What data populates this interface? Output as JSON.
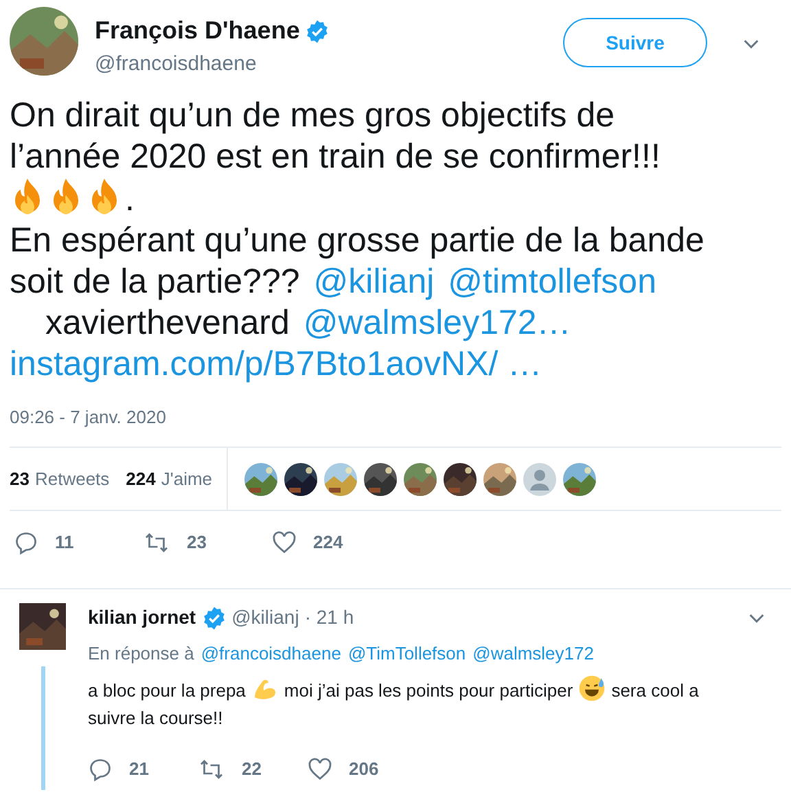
{
  "author": {
    "name": "François D'haene",
    "handle": "@francoisdhaene",
    "verified": true,
    "avatar": {
      "kind": "picture"
    }
  },
  "follow_button": "Suivre",
  "body": [
    [
      {
        "kind": "text",
        "text": "On dirait qu’un de mes gros objectifs de"
      }
    ],
    [
      {
        "kind": "text",
        "text": "l’année 2020 est en train de se confirmer!!!"
      }
    ],
    [
      {
        "kind": "fire"
      },
      {
        "kind": "fire"
      },
      {
        "kind": "fire"
      },
      {
        "kind": "text",
        "text": "."
      }
    ],
    [
      {
        "kind": "text",
        "text": "En espérant qu’une grosse partie de la bande"
      }
    ],
    [
      {
        "kind": "text",
        "text": "soit de la partie???"
      },
      {
        "kind": "mention",
        "text": "@kilianj"
      },
      {
        "kind": "mention",
        "text": "@timtollefson"
      }
    ],
    [
      {
        "kind": "text",
        "text": "xavierthevenard"
      },
      {
        "kind": "mention",
        "text": "@walmsley172…"
      }
    ],
    [
      {
        "kind": "link",
        "text": "instagram.com/p/B7Bto1aovNX/ …"
      }
    ]
  ],
  "timestamp": "09:26 - 7 janv. 2020",
  "stats": [
    {
      "count": "23",
      "label": "Retweets"
    },
    {
      "count": "224",
      "label": "J'aime"
    }
  ],
  "likers": [
    {
      "kind": "picture"
    },
    {
      "kind": "picture"
    },
    {
      "kind": "picture"
    },
    {
      "kind": "picture"
    },
    {
      "kind": "picture"
    },
    {
      "kind": "picture"
    },
    {
      "kind": "picture"
    },
    {
      "kind": "default"
    },
    {
      "kind": "picture"
    }
  ],
  "actions": [
    {
      "kind": "reply",
      "count": "11"
    },
    {
      "kind": "retweet",
      "count": "23"
    },
    {
      "kind": "like",
      "count": "224"
    }
  ],
  "reply": {
    "name": "kilian jornet",
    "verified": true,
    "handle": "@kilianj",
    "time": "· 21 h",
    "avatar": {
      "kind": "picture"
    },
    "in_reply_to": "En réponse à",
    "mentions": [
      "@francoisdhaene",
      "@TimTollefson",
      "@walmsley172"
    ],
    "body": [
      [
        {
          "kind": "text",
          "text": "a bloc pour la prepa"
        },
        {
          "kind": "muscle"
        },
        {
          "kind": "text",
          "text": "moi j’ai pas les points pour participer"
        },
        {
          "kind": "sweat-smile"
        },
        {
          "kind": "text",
          "text": "sera cool a"
        }
      ],
      [
        {
          "kind": "text",
          "text": "suivre la course!!"
        }
      ]
    ],
    "actions": [
      {
        "kind": "reply",
        "count": "21"
      },
      {
        "kind": "retweet",
        "count": "22"
      },
      {
        "kind": "like",
        "count": "206"
      }
    ]
  }
}
